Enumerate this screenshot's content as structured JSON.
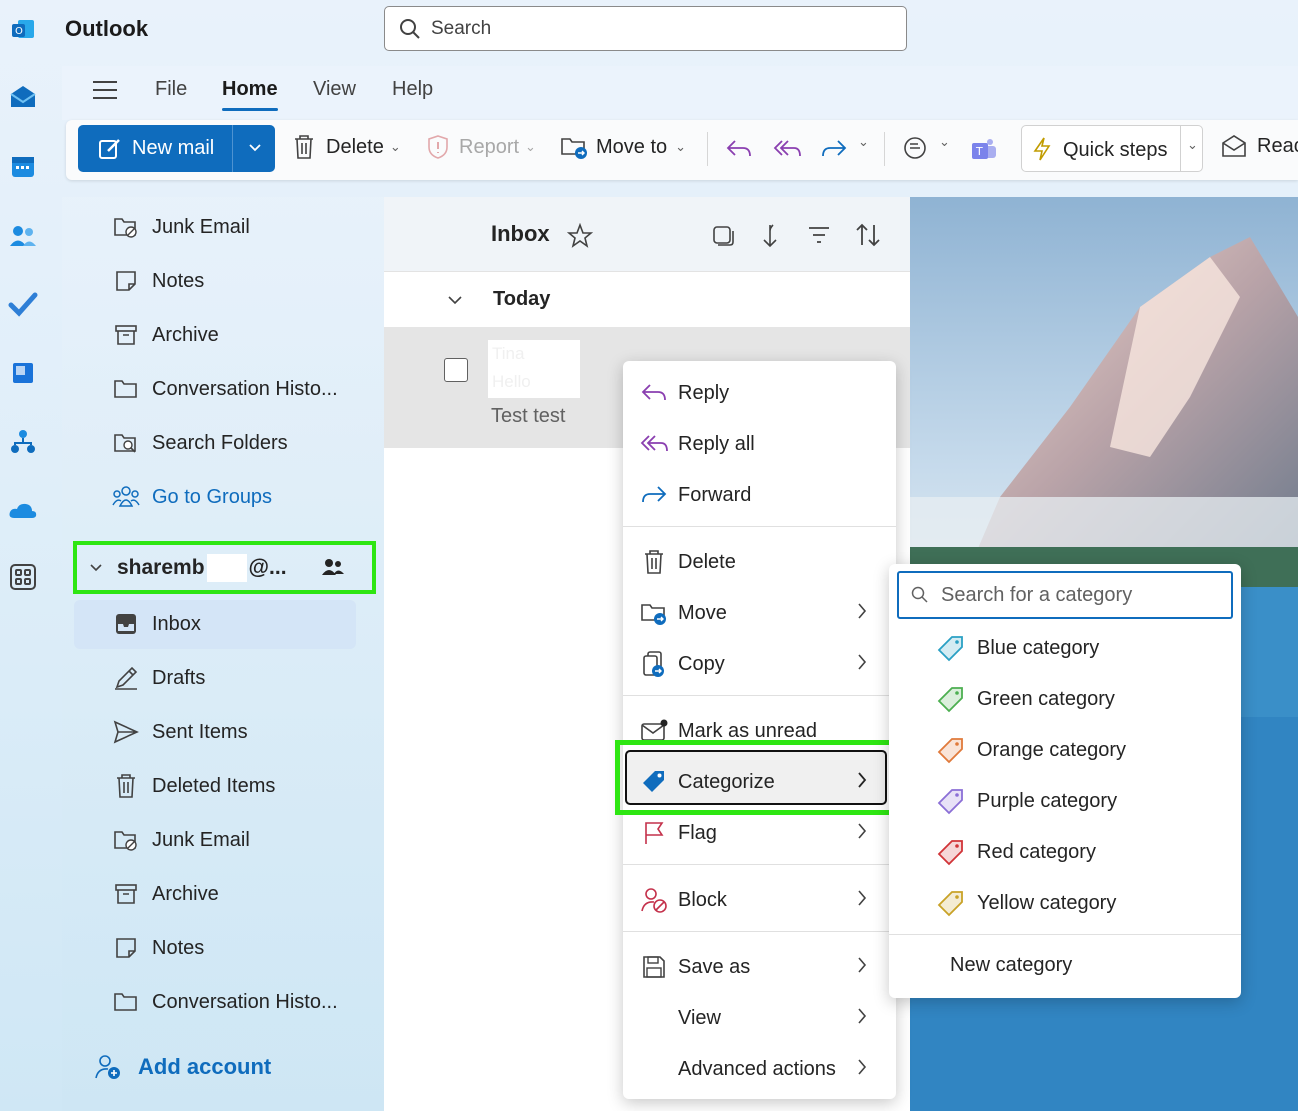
{
  "app": {
    "title": "Outlook"
  },
  "search": {
    "placeholder": "Search"
  },
  "menu_tabs": [
    "File",
    "Home",
    "View",
    "Help"
  ],
  "ribbon": {
    "new_mail": "New mail",
    "delete": "Delete",
    "report": "Report",
    "move_to": "Move to",
    "quick_steps": "Quick steps",
    "read": "Reac"
  },
  "folders_top": [
    "Junk Email",
    "Notes",
    "Archive",
    "Conversation Histo...",
    "Search Folders"
  ],
  "go_to_groups": "Go to Groups",
  "account": {
    "name_part1": "sharemb",
    "name_part2": "@..."
  },
  "folders_account": [
    "Inbox",
    "Drafts",
    "Sent Items",
    "Deleted Items",
    "Junk Email",
    "Archive",
    "Notes",
    "Conversation Histo..."
  ],
  "add_account": "Add account",
  "message_list": {
    "title": "Inbox",
    "group": "Today",
    "message": {
      "sender": "Tina",
      "subject": "Hello",
      "preview": "Test test"
    }
  },
  "context_menu": {
    "items": [
      "Reply",
      "Reply all",
      "Forward",
      "Delete",
      "Move",
      "Copy",
      "Mark as unread",
      "Categorize",
      "Flag",
      "Block",
      "Save as",
      "View",
      "Advanced actions"
    ]
  },
  "category_menu": {
    "search_placeholder": "Search for a category",
    "categories": [
      {
        "label": "Blue category",
        "color": "#2aa0c4"
      },
      {
        "label": "Green category",
        "color": "#4caf50"
      },
      {
        "label": "Orange category",
        "color": "#e07a3b"
      },
      {
        "label": "Purple category",
        "color": "#8b6fd6"
      },
      {
        "label": "Red category",
        "color": "#d13438"
      },
      {
        "label": "Yellow category",
        "color": "#c9a227"
      }
    ],
    "new_category": "New category"
  },
  "colors": {
    "accent": "#0f6cbd",
    "highlight": "#2ee612"
  }
}
